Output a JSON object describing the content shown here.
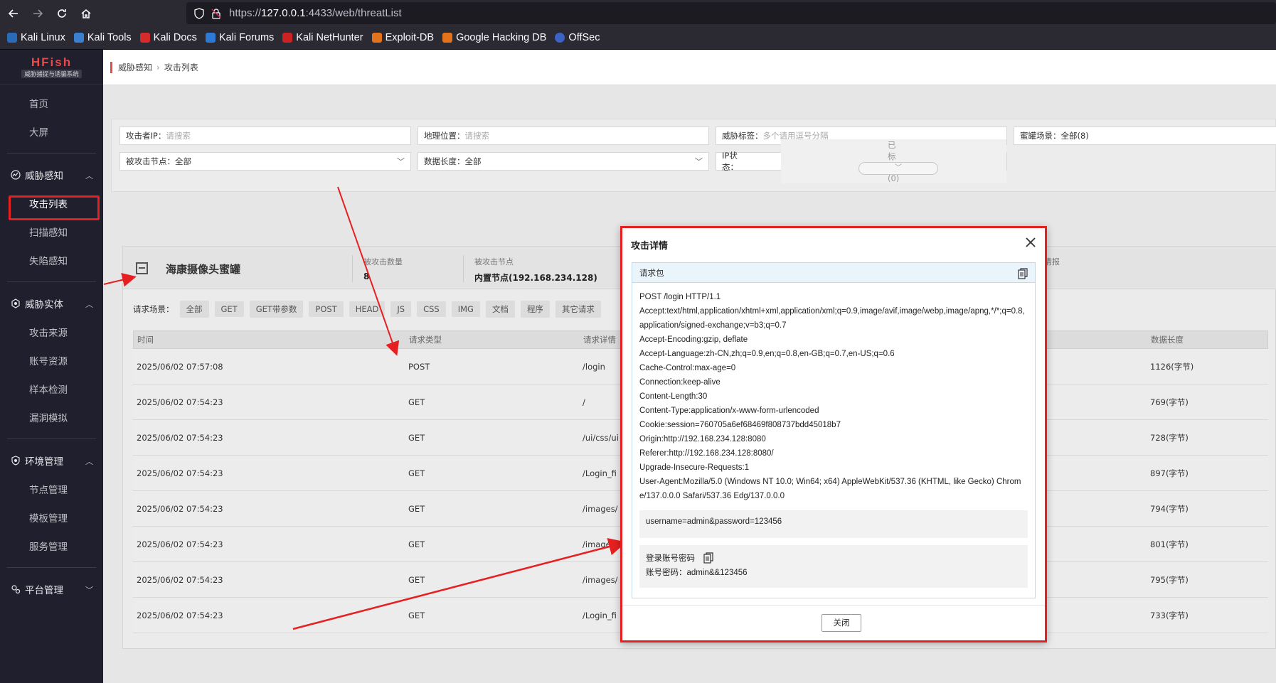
{
  "browser": {
    "url_prefix": "https://",
    "url_host": "127.0.0.1",
    "url_rest": ":4433/web/threatList",
    "bookmarks": [
      "Kali Linux",
      "Kali Tools",
      "Kali Docs",
      "Kali Forums",
      "Kali NetHunter",
      "Exploit-DB",
      "Google Hacking DB",
      "OffSec"
    ]
  },
  "sidebar": {
    "logo_title": "HFish",
    "logo_subtitle": "威胁捕捉与诱骗系统",
    "top_items": [
      "首页",
      "大屏"
    ],
    "groups": [
      {
        "label": "威胁感知",
        "items": [
          "攻击列表",
          "扫描感知",
          "失陷感知"
        ]
      },
      {
        "label": "威胁实体",
        "items": [
          "攻击来源",
          "账号资源",
          "样本检测",
          "漏洞模拟"
        ]
      },
      {
        "label": "环境管理",
        "items": [
          "节点管理",
          "模板管理",
          "服务管理"
        ]
      },
      {
        "label": "平台管理",
        "items": []
      }
    ]
  },
  "breadcrumb": {
    "parent": "威胁感知",
    "current": "攻击列表"
  },
  "filters": {
    "attacker_ip_label": "攻击者IP：",
    "attacker_ip_ph": "请搜索",
    "geo_label": "地理位置：",
    "geo_ph": "请搜索",
    "tag_label": "威胁标签：",
    "tag_ph": "多个请用逗号分隔",
    "scene_label": "蜜罐场景：",
    "scene_value": "全部(8)",
    "node_label": "被攻击节点：",
    "node_value": "全部",
    "length_label": "数据长度：",
    "length_value": "全部",
    "ipstate_label": "IP状态：",
    "ipstate_value": "已标记(0)"
  },
  "honeypot": {
    "name": "海康摄像头蜜罐",
    "attack_count_label": "被攻击数量",
    "attack_count": "8",
    "node_label": "被攻击节点",
    "node_value": "内置节点(192.168.234.128)",
    "intel_label": "情报"
  },
  "chips": {
    "label": "请求场景：",
    "items": [
      "全部",
      "GET",
      "GET带参数",
      "POST",
      "HEAD",
      "JS",
      "CSS",
      "IMG",
      "文档",
      "程序",
      "其它请求"
    ]
  },
  "table": {
    "headers": [
      "时间",
      "请求类型",
      "请求详情",
      "数据长度"
    ],
    "rows": [
      [
        "2025/06/02 07:57:08",
        "POST",
        "/login",
        "1126(字节)"
      ],
      [
        "2025/06/02 07:54:23",
        "GET",
        "/",
        "769(字节)"
      ],
      [
        "2025/06/02 07:54:23",
        "GET",
        "/ui/css/ui",
        "728(字节)"
      ],
      [
        "2025/06/02 07:54:23",
        "GET",
        "/Login_fi",
        "897(字节)"
      ],
      [
        "2025/06/02 07:54:23",
        "GET",
        "/images/",
        "794(字节)"
      ],
      [
        "2025/06/02 07:54:23",
        "GET",
        "/images/",
        "801(字节)"
      ],
      [
        "2025/06/02 07:54:23",
        "GET",
        "/images/",
        "795(字节)"
      ],
      [
        "2025/06/02 07:54:23",
        "GET",
        "/Login_fi",
        "733(字节)"
      ]
    ]
  },
  "modal": {
    "title": "攻击详情",
    "section": "请求包",
    "request_lines": [
      "POST  /login  HTTP/1.1",
      "Accept:text/html,application/xhtml+xml,application/xml;q=0.9,image/avif,image/webp,image/apng,*/*;q=0.8,application/signed-exchange;v=b3;q=0.7",
      "Accept-Encoding:gzip, deflate",
      "Accept-Language:zh-CN,zh;q=0.9,en;q=0.8,en-GB;q=0.7,en-US;q=0.6",
      "Cache-Control:max-age=0",
      "Connection:keep-alive",
      "Content-Length:30",
      "Content-Type:application/x-www-form-urlencoded",
      "Cookie:session=760705a6ef68469f808737bdd45018b7",
      "Origin:http://192.168.234.128:8080",
      "Referer:http://192.168.234.128:8080/",
      "Upgrade-Insecure-Requests:1",
      "User-Agent:Mozilla/5.0 (Windows NT 10.0; Win64; x64) AppleWebKit/537.36 (KHTML, like Gecko) Chrome/137.0.0.0 Safari/537.36 Edg/137.0.0.0"
    ],
    "body": "username=admin&password=123456",
    "cred_title": "登录账号密码",
    "cred_value": "账号密码：admin&&123456",
    "close_label": "关闭"
  },
  "colors": {
    "accent_red": "#e62020",
    "sidebar_bg": "#1f1f2d",
    "chrome_bg": "#2b2a33"
  }
}
